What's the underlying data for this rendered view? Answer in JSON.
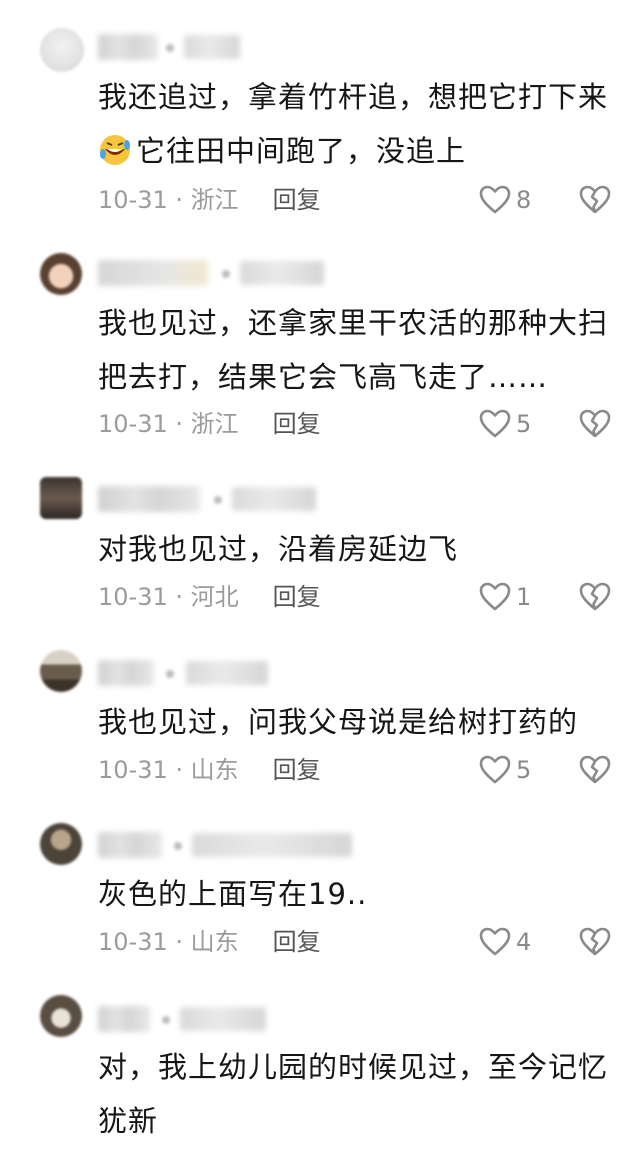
{
  "comments": [
    {
      "lines": [
        "我还追过，拿着竹杆追，想把它打下来",
        "它往田中间跑了，没追上"
      ],
      "has_emoji": true,
      "emoji_icon": "rolling-on-floor-laughing-emoji",
      "date": "10-31",
      "region": "浙江",
      "reply": "回复",
      "likes": "8"
    },
    {
      "lines": [
        "我也见过，还拿家里干农活的那种大扫",
        "把去打，结果它会飞高飞走了……"
      ],
      "has_emoji": false,
      "date": "10-31",
      "region": "浙江",
      "reply": "回复",
      "likes": "5"
    },
    {
      "lines": [
        "对我也见过，沿着房延边飞"
      ],
      "has_emoji": false,
      "date": "10-31",
      "region": "河北",
      "reply": "回复",
      "likes": "1"
    },
    {
      "lines": [
        "我也见过，问我父母说是给树打药的"
      ],
      "has_emoji": false,
      "date": "10-31",
      "region": "山东",
      "reply": "回复",
      "likes": "5"
    },
    {
      "lines": [
        "灰色的上面写在19.."
      ],
      "has_emoji": false,
      "date": "10-31",
      "region": "山东",
      "reply": "回复",
      "likes": "4"
    },
    {
      "lines": [
        "对，我上幼儿园的时候见过，至今记忆",
        "犹新"
      ],
      "has_emoji": false
    }
  ],
  "meta_separator": " · ",
  "colors": {
    "text": "#161616",
    "meta": "#9b9b9b",
    "reply": "#555555",
    "icon": "#8a8a8a"
  }
}
